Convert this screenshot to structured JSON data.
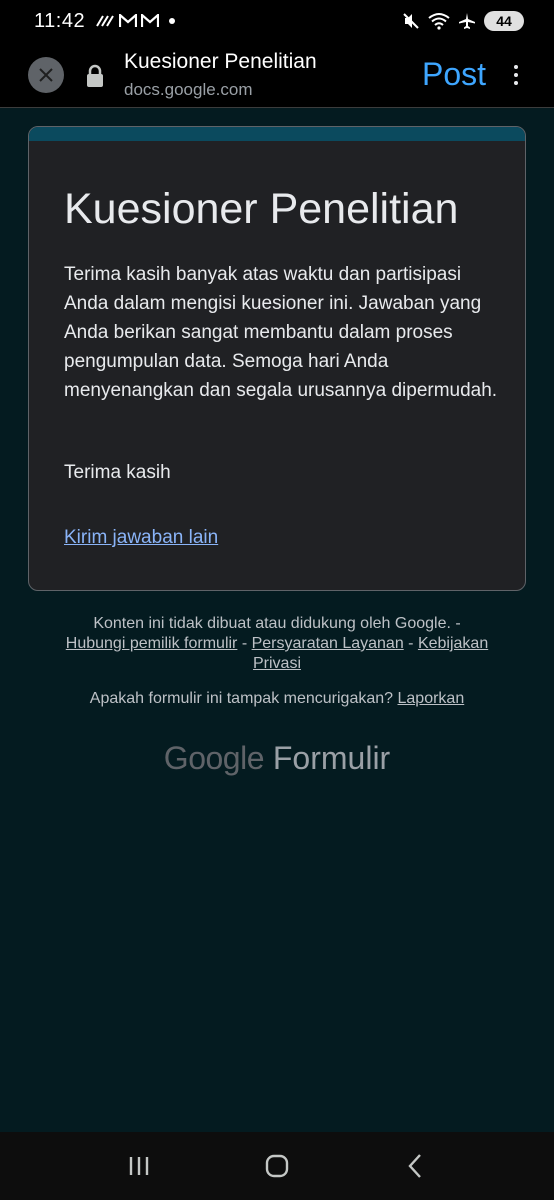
{
  "status_bar": {
    "time": "11:42",
    "left_icons": [
      "signal-strength-icon",
      "gmail-icon",
      "gmail-icon",
      "dot-icon"
    ],
    "right_icons": [
      "mute-icon",
      "wifi-icon",
      "airplane-icon"
    ],
    "battery": "44"
  },
  "browser": {
    "title": "Kuesioner Penelitian",
    "url": "docs.google.com",
    "action_label": "Post"
  },
  "form": {
    "title": "Kuesioner Penelitian",
    "body": "Terima kasih banyak atas waktu dan partisipasi Anda dalam mengisi kuesioner ini. Jawaban yang Anda berikan sangat membantu dalam proses pengumpulan data. Semoga hari Anda menyenangkan dan segala urusannya dipermudah.",
    "thanks": "Terima kasih",
    "link": "Kirim jawaban lain",
    "accent": "#0b4a5e"
  },
  "footer": {
    "notice": "Konten ini tidak dibuat atau didukung oleh Google. -",
    "contact_owner": "Hubungi pemilik formulir",
    "sep1": " - ",
    "terms": "Persyaratan Layanan",
    "sep2": " - ",
    "privacy": "Kebijakan Privasi",
    "suspicious": "Apakah formulir ini tampak mencurigakan?",
    "report": "Laporkan",
    "brand_google": "Google",
    "brand_product": "Formulir"
  },
  "colors": {
    "background": "#041b20",
    "card": "#202124",
    "link": "#8ab4f8",
    "post": "#3ea6ff"
  }
}
